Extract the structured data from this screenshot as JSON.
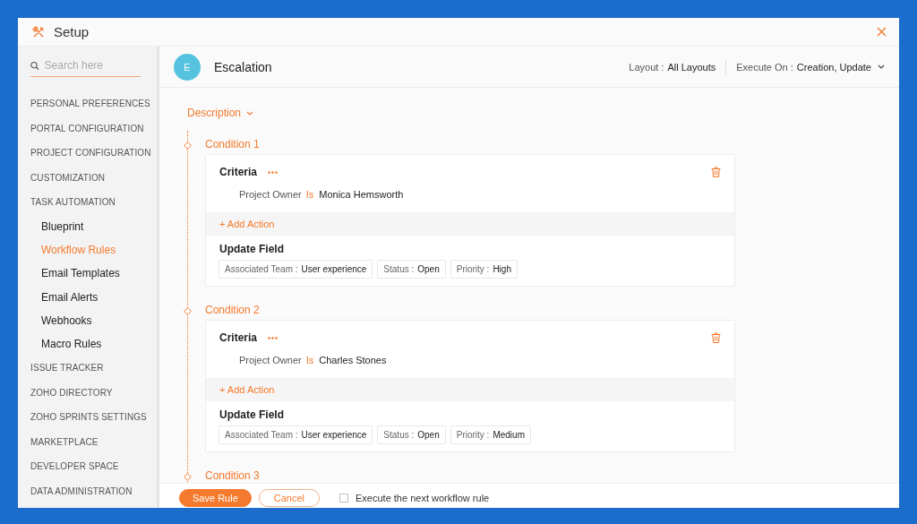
{
  "window": {
    "title": "Setup"
  },
  "sidebar": {
    "search": {
      "placeholder": "Search here"
    },
    "items": [
      {
        "label": "PERSONAL PREFERENCES",
        "kind": "section",
        "selected": false
      },
      {
        "label": "PORTAL CONFIGURATION",
        "kind": "section",
        "selected": false
      },
      {
        "label": "PROJECT CONFIGURATION",
        "kind": "section",
        "selected": false
      },
      {
        "label": "CUSTOMIZATION",
        "kind": "section",
        "selected": false
      },
      {
        "label": "TASK AUTOMATION",
        "kind": "section",
        "selected": false
      },
      {
        "label": "Blueprint",
        "kind": "sub",
        "selected": false
      },
      {
        "label": "Workflow Rules",
        "kind": "sub",
        "selected": true
      },
      {
        "label": "Email Templates",
        "kind": "sub",
        "selected": false
      },
      {
        "label": "Email Alerts",
        "kind": "sub",
        "selected": false
      },
      {
        "label": "Webhooks",
        "kind": "sub",
        "selected": false
      },
      {
        "label": "Macro Rules",
        "kind": "sub",
        "selected": false
      },
      {
        "label": "ISSUE TRACKER",
        "kind": "section",
        "selected": false
      },
      {
        "label": "ZOHO DIRECTORY",
        "kind": "section",
        "selected": false
      },
      {
        "label": "ZOHO SPRINTS SETTINGS",
        "kind": "section",
        "selected": false
      },
      {
        "label": "MARKETPLACE",
        "kind": "section",
        "selected": false
      },
      {
        "label": "DEVELOPER SPACE",
        "kind": "section",
        "selected": false
      },
      {
        "label": "DATA ADMINISTRATION",
        "kind": "section",
        "selected": false
      }
    ]
  },
  "rule": {
    "avatar": "E",
    "name": "Escalation",
    "layout_label": "Layout :",
    "layout_value": "All Layouts",
    "execute_label": "Execute On :",
    "execute_value": "Creation, Update"
  },
  "description": {
    "label": "Description"
  },
  "conditions": [
    {
      "title": "Condition 1",
      "criteria_label": "Criteria",
      "criterion": {
        "field": "Project Owner",
        "operator": "Is",
        "value": "Monica Hemsworth"
      },
      "add_action": "+ Add Action",
      "action_title": "Update Field",
      "fields": [
        {
          "label": "Associated Team :",
          "value": "User experience"
        },
        {
          "label": "Status :",
          "value": "Open"
        },
        {
          "label": "Priority :",
          "value": "High"
        }
      ]
    },
    {
      "title": "Condition 2",
      "criteria_label": "Criteria",
      "criterion": {
        "field": "Project Owner",
        "operator": "Is",
        "value": "Charles Stones"
      },
      "add_action": "+ Add Action",
      "action_title": "Update Field",
      "fields": [
        {
          "label": "Associated Team :",
          "value": "User experience"
        },
        {
          "label": "Status :",
          "value": "Open"
        },
        {
          "label": "Priority :",
          "value": "Medium"
        }
      ]
    },
    {
      "title": "Condition 3"
    }
  ],
  "footer": {
    "save": "Save Rule",
    "cancel": "Cancel",
    "next_rule": {
      "label": "Execute the next workflow rule",
      "checked": false
    }
  }
}
